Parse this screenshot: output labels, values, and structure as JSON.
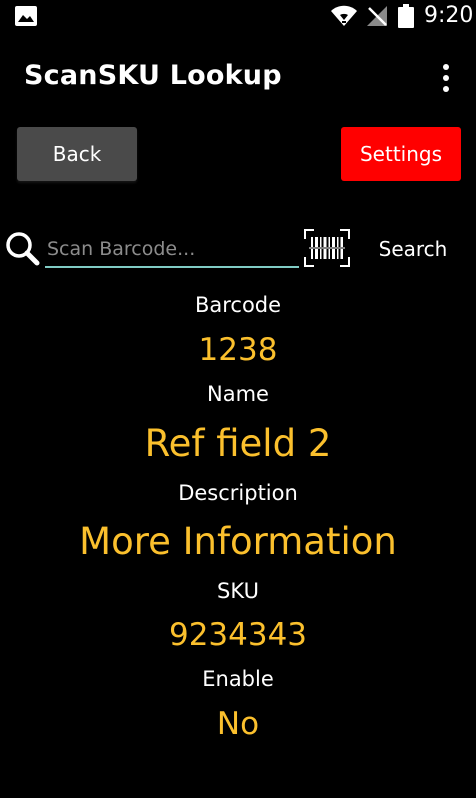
{
  "status_bar": {
    "time": "9:20",
    "icons": [
      "gallery-icon",
      "wifi-icon",
      "signal-off-icon",
      "battery-icon"
    ]
  },
  "app_bar": {
    "title": "ScanSKU Lookup",
    "menu_icon": "overflow-menu-icon"
  },
  "buttons": {
    "back_label": "Back",
    "settings_label": "Settings"
  },
  "search": {
    "placeholder": "Scan Barcode...",
    "value": "",
    "search_label": "Search",
    "icons": [
      "search-icon",
      "barcode-scan-icon"
    ]
  },
  "result": {
    "barcode_label": "Barcode",
    "barcode_value": "1238",
    "name_label": "Name",
    "name_value": "Ref field 2",
    "description_label": "Description",
    "description_value": "More Information",
    "sku_label": "SKU",
    "sku_value": "9234343",
    "enable_label": "Enable",
    "enable_value": "No"
  },
  "colors": {
    "background": "#000000",
    "value_text": "#fbc02d",
    "settings_button": "#ff0000",
    "back_button": "#4a4a4a",
    "input_underline": "#80cbc4"
  }
}
